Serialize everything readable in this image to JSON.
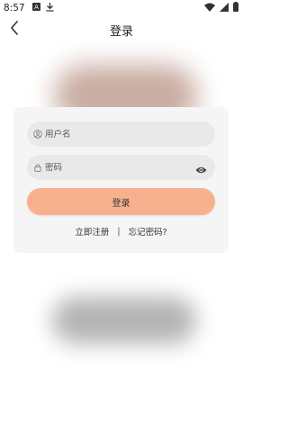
{
  "status_bar": {
    "time": "8:57",
    "icons_left": [
      "a-box-icon",
      "download-icon"
    ],
    "icons_right": [
      "wifi-icon",
      "signal-icon",
      "battery-icon"
    ]
  },
  "header": {
    "title": "登录",
    "back_icon": "chevron-left-icon"
  },
  "form": {
    "username": {
      "placeholder": "用户名",
      "value": "",
      "icon": "user-icon"
    },
    "password": {
      "placeholder": "密码",
      "value": "",
      "icon": "lock-icon",
      "toggle_icon": "eye-icon"
    },
    "login_label": "登录",
    "register_link": "立即注册",
    "separator": "|",
    "forgot_link": "忘记密码?"
  },
  "colors": {
    "login_button": "#f8b18e",
    "card_background": "#f5f5f5",
    "field_background": "#e9e9e9"
  }
}
